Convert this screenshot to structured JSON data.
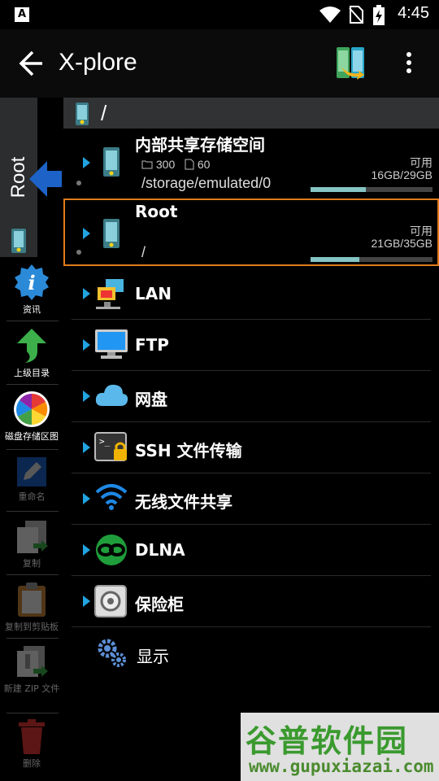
{
  "status_bar": {
    "app_badge": "A",
    "time": "4:45"
  },
  "toolbar": {
    "title": "X-plore"
  },
  "left_bar": {
    "vertical_tab": "Root",
    "tools": [
      {
        "label": "资讯"
      },
      {
        "label": "上级目录"
      },
      {
        "label": "磁盘存储区图"
      },
      {
        "label": "重命名"
      },
      {
        "label": "复制"
      },
      {
        "label": "复制到剪贴板"
      },
      {
        "label": "新建 ZIP 文件"
      },
      {
        "label": "删除"
      }
    ]
  },
  "pane": {
    "path": "/",
    "volumes": [
      {
        "name": "内部共享存储空间",
        "folders": "300",
        "files": "60",
        "path": "/storage/emulated/0",
        "avail_label": "可用",
        "size": "16GB/29GB",
        "used_fraction": 0.45
      },
      {
        "name": "Root",
        "path": "/",
        "avail_label": "可用",
        "size": "21GB/35GB",
        "used_fraction": 0.4
      }
    ],
    "entries": [
      {
        "label": "LAN"
      },
      {
        "label": "FTP"
      },
      {
        "label": "网盘"
      },
      {
        "label": "SSH 文件传输"
      },
      {
        "label": "无线文件共享"
      },
      {
        "label": "DLNA"
      },
      {
        "label": "保险柜"
      },
      {
        "label": "显示"
      }
    ]
  },
  "watermark": {
    "title": "谷普软件园",
    "url": "www.gupuxiazai.com"
  },
  "colors": {
    "accent_blue": "#21a4e0",
    "selection_orange": "#e07b1c",
    "bar_fill": "#86c4c4",
    "watermark_green": "#3a9a2e"
  }
}
